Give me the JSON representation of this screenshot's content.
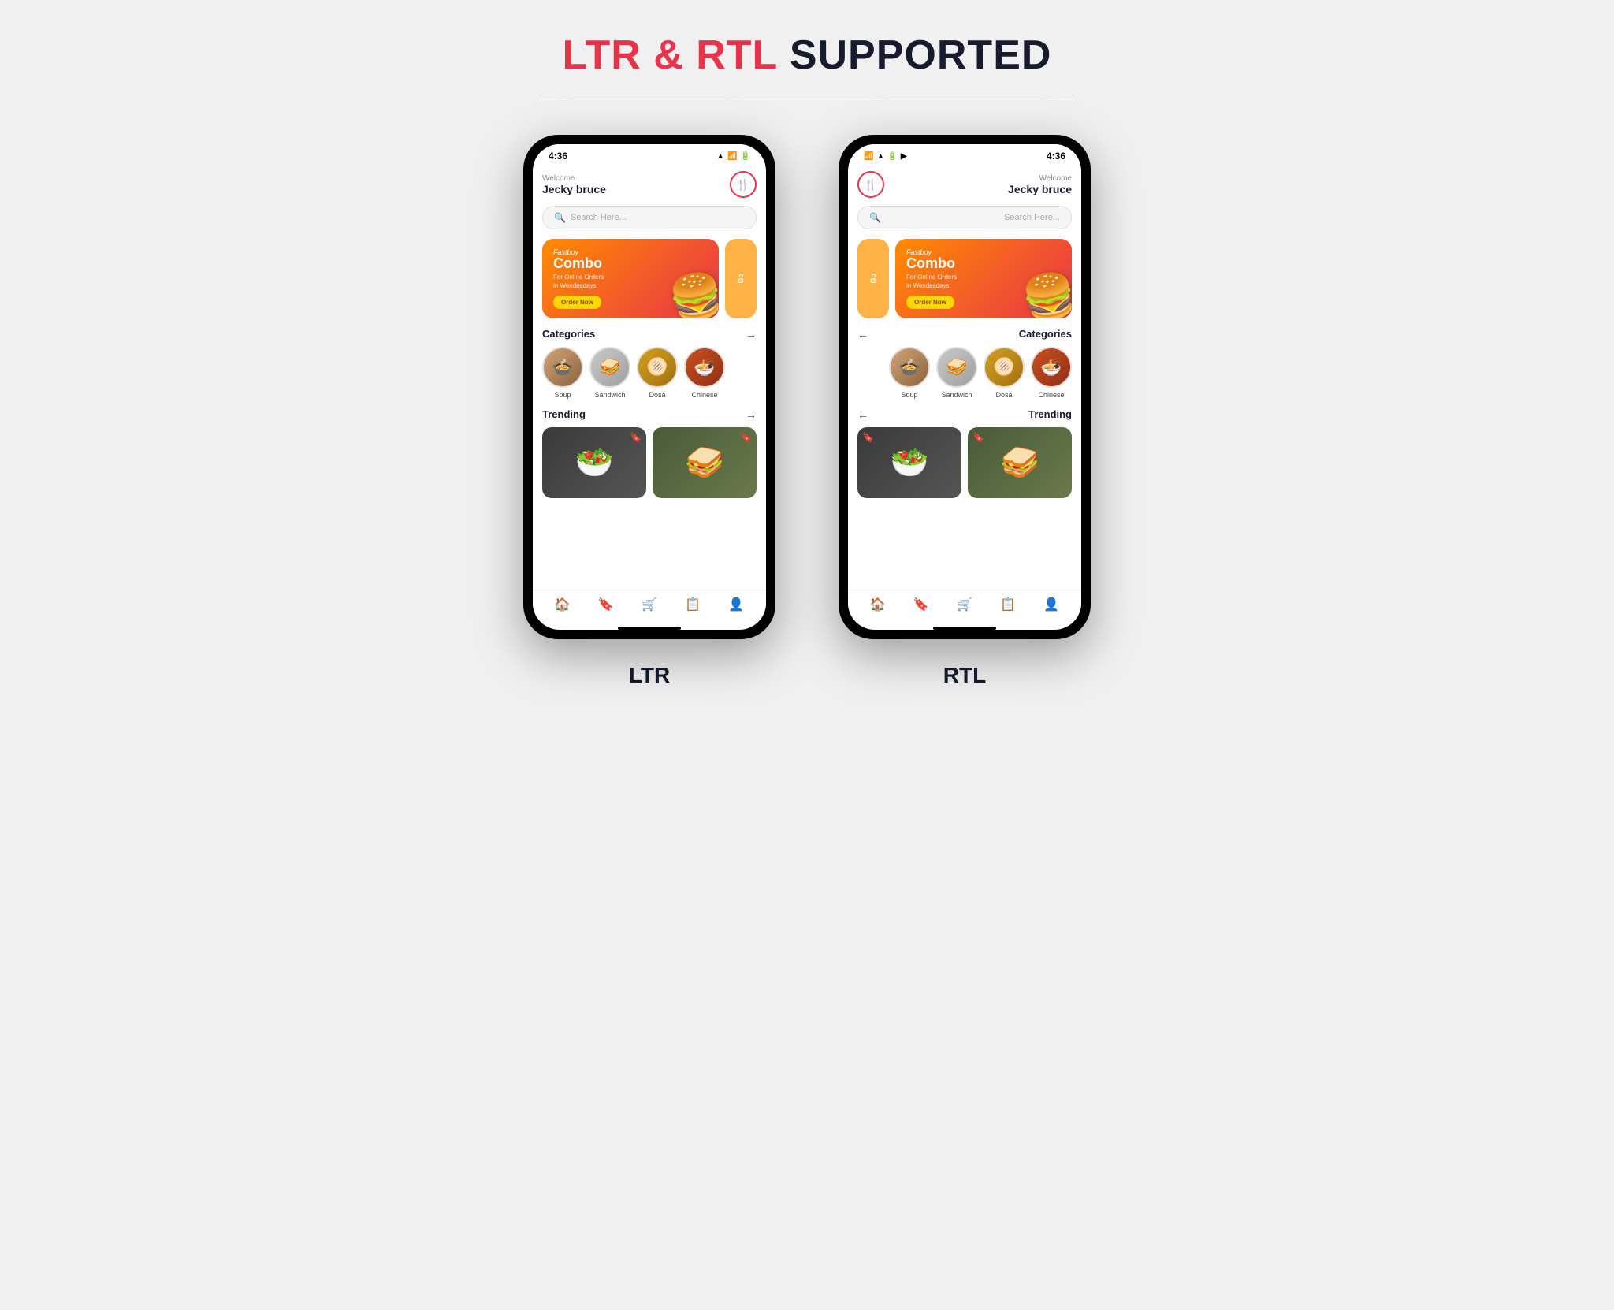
{
  "header": {
    "title_ltr": "LTR",
    "ampersand": " & ",
    "title_rtl": "RTL",
    "supported": " SUPPORTED"
  },
  "ltr_phone": {
    "label": "LTR",
    "time": "4:36",
    "welcome": "Welcome",
    "user_name": "Jecky bruce",
    "search_placeholder": "Search Here...",
    "banner": {
      "title_small": "Fastboy",
      "title_big": "Combo",
      "subtitle1": "For Online Orders",
      "subtitle2": "in Wendesdays.",
      "btn_label": "Order Now",
      "secondary_text": "Go"
    },
    "categories_title": "Categories",
    "categories": [
      {
        "label": "Soup",
        "emoji": "🍲"
      },
      {
        "label": "Sandwich",
        "emoji": "🥪"
      },
      {
        "label": "Dosa",
        "emoji": "🫓"
      },
      {
        "label": "Chinese",
        "emoji": "🍜"
      }
    ],
    "trending_title": "Trending",
    "nav_icons": [
      "🏠",
      "🔖",
      "🛒",
      "📋",
      "👤"
    ]
  },
  "rtl_phone": {
    "label": "RTL",
    "time": "4:36",
    "welcome": "Welcome",
    "user_name": "Jecky bruce",
    "search_placeholder": "Search Here...",
    "banner": {
      "title_small": "Fastboy",
      "title_big": "Combo",
      "subtitle1": "For Online Orders",
      "subtitle2": "in Wendesdays.",
      "btn_label": "Order Now",
      "secondary_text": "Go"
    },
    "categories_title": "Categories",
    "categories": [
      {
        "label": "Chinese",
        "emoji": "🍜"
      },
      {
        "label": "Dosa",
        "emoji": "🫓"
      },
      {
        "label": "Sandwich",
        "emoji": "🥪"
      },
      {
        "label": "Soup",
        "emoji": "🍲"
      }
    ],
    "trending_title": "Trending",
    "nav_icons": [
      "👤",
      "📋",
      "🛒",
      "🔖",
      "🏠"
    ]
  }
}
